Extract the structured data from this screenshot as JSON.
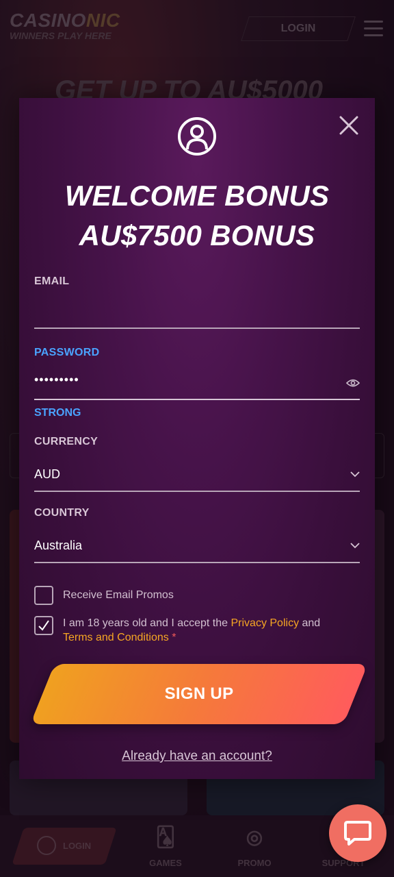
{
  "background": {
    "brand": "CASINO",
    "brand_suffix": "NIC",
    "tagline": "WINNERS PLAY HERE",
    "login_label": "LOGIN",
    "hero_text": "GET UP TO AU$5000",
    "bottom_nav": {
      "login": "LOGIN",
      "games": "GAMES",
      "promo": "PROMO",
      "support": "SUPPORT"
    }
  },
  "modal": {
    "headline_line1": "WELCOME BONUS",
    "headline_line2": "AU$7500 BONUS",
    "email": {
      "label": "EMAIL",
      "value": "",
      "placeholder": ""
    },
    "password": {
      "label": "PASSWORD",
      "value": "•••••••••",
      "strength": "STRONG"
    },
    "currency": {
      "label": "CURRENCY",
      "value": "AUD"
    },
    "country": {
      "label": "COUNTRY",
      "value": "Australia"
    },
    "promo_checkbox": {
      "label": "Receive Email Promos",
      "checked": false
    },
    "terms_checkbox": {
      "text_prefix": "I am 18 years old and I accept the ",
      "privacy_link": "Privacy Policy",
      "text_and": " and",
      "terms_link": "Terms and Conditions",
      "required_mark": "*",
      "checked": true
    },
    "signup_label": "SIGN UP",
    "account_link": "Already have an account?"
  },
  "colors": {
    "accent_blue": "#4aa3ff",
    "link_orange": "#f6a623",
    "signup_start": "#f0a020",
    "signup_end": "#ff5c5c",
    "chat_fab": "#f06e62"
  }
}
